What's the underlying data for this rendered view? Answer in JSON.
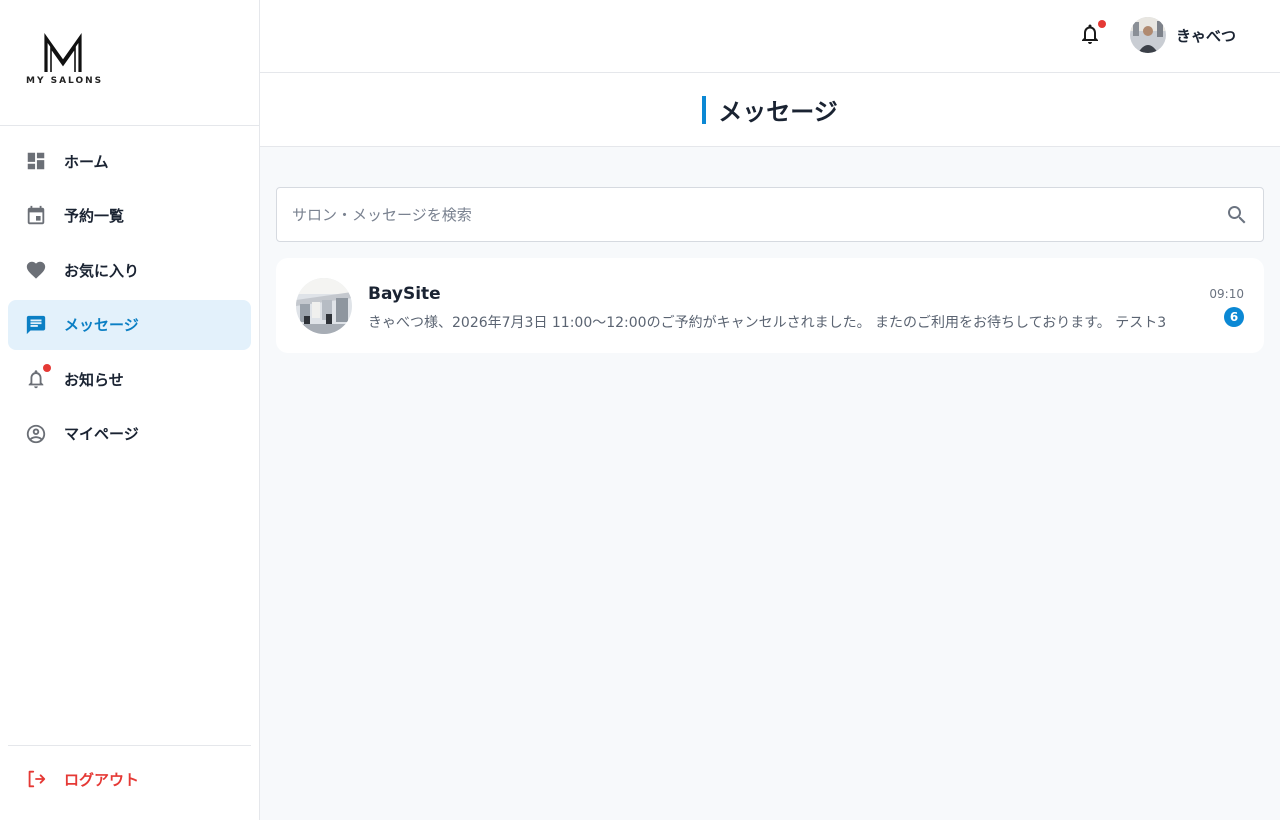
{
  "brand": {
    "logo_text": "MY SALONS"
  },
  "sidebar": {
    "items": [
      {
        "label": "ホーム",
        "icon": "dashboard-icon"
      },
      {
        "label": "予約一覧",
        "icon": "calendar-icon"
      },
      {
        "label": "お気に入り",
        "icon": "heart-icon"
      },
      {
        "label": "メッセージ",
        "icon": "chat-icon",
        "active": true
      },
      {
        "label": "お知らせ",
        "icon": "bell-icon",
        "has_notification": true
      },
      {
        "label": "マイページ",
        "icon": "account-circle-icon"
      }
    ],
    "logout_label": "ログアウト"
  },
  "header": {
    "user_name": "きゃべつ",
    "has_notification": true
  },
  "page": {
    "title": "メッセージ"
  },
  "search": {
    "placeholder": "サロン・メッセージを検索",
    "value": ""
  },
  "messages": [
    {
      "salon_name": "BaySite",
      "preview": "きゃべつ様、2026年7月3日 11:00〜12:00のご予約がキャンセルされました。 またのご利用をお待ちしております。 テスト3",
      "time": "09:10",
      "unread_count": "6"
    }
  ],
  "colors": {
    "accent": "#0b88d4",
    "active_bg": "#e3f1fb",
    "danger": "#e53935",
    "text": "#1a2332",
    "muted": "#5b6472",
    "page_bg": "#f7f9fb"
  }
}
